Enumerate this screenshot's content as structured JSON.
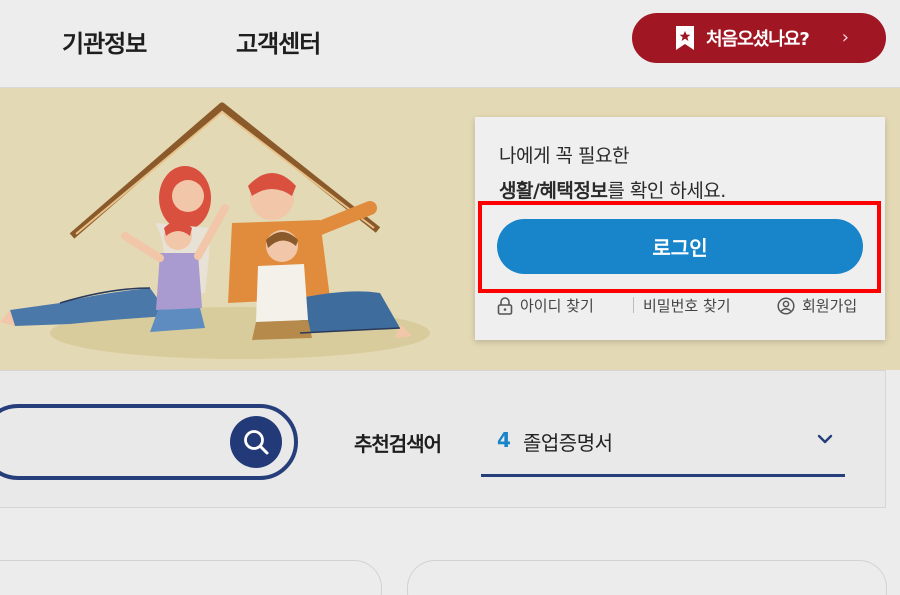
{
  "header": {
    "nav": [
      "기관정보",
      "고객센터"
    ],
    "first_visit_label": "처음오셨나요?",
    "first_visit_chevron": "›"
  },
  "login_card": {
    "message_line1": "나에게 꼭 필요한",
    "message_line2_bold": "생활/혜택정보",
    "message_line2_rest": "를 확인 하세요.",
    "login_button": "로그인",
    "links": {
      "find_id": "아이디 찾기",
      "find_password": "비밀번호 찾기",
      "signup": "회원가입"
    }
  },
  "search": {
    "input_value": "",
    "recommended_label": "추천검색어",
    "recommended_number": "4",
    "recommended_term": "졸업증명서"
  },
  "colors": {
    "brand_navy": "#263e7a",
    "login_blue": "#1884c9",
    "first_visit_red": "#a01623",
    "highlight_red": "#ff0000"
  },
  "icons": [
    "bookmark-icon",
    "chevron-right-icon",
    "lock-icon",
    "user-circle-icon",
    "search-icon",
    "chevron-down-icon"
  ]
}
